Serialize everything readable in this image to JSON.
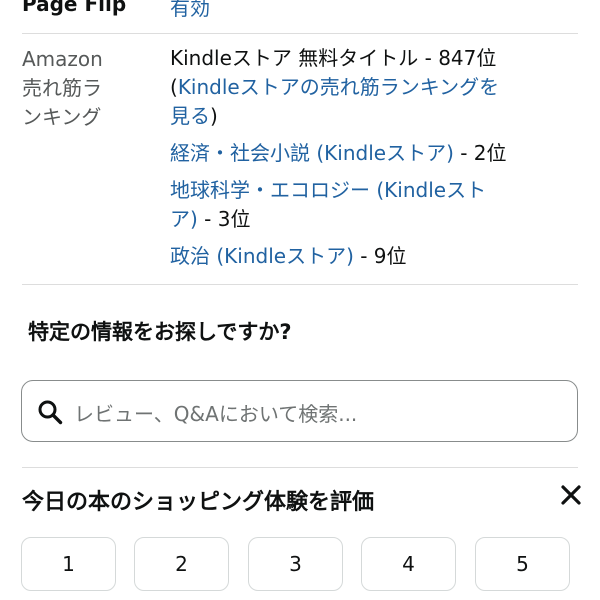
{
  "page_flip": {
    "label": "Page Flip",
    "value": "有効"
  },
  "bestseller": {
    "label_lines": [
      "Amazon",
      "売れ筋ラ",
      "ンキング"
    ],
    "overall": {
      "prefix": "Kindleストア 無料タイトル - 847位",
      "open_paren": "(",
      "link_line1": "Kindleストアの売れ筋ランキングを",
      "link_line2": "見る",
      "close_paren": ")"
    },
    "categories": [
      {
        "name": "経済・社会小説 (Kindleストア)",
        "rank": " - 2位"
      },
      {
        "name_line1": "地球科学・エコロジー (Kindleスト",
        "name_line2": "ア)",
        "rank": " - 3位"
      },
      {
        "name": "政治 (Kindleストア)",
        "rank": " - 9位"
      }
    ]
  },
  "search_section": {
    "title": "特定の情報をお探しですか?",
    "placeholder": "レビュー、Q&Aにおいて検索...",
    "icon": "search-icon"
  },
  "rating": {
    "title": "今日の本のショッピング体験を評価",
    "close_icon": "close-icon",
    "options": [
      "1",
      "2",
      "3",
      "4",
      "5"
    ]
  }
}
